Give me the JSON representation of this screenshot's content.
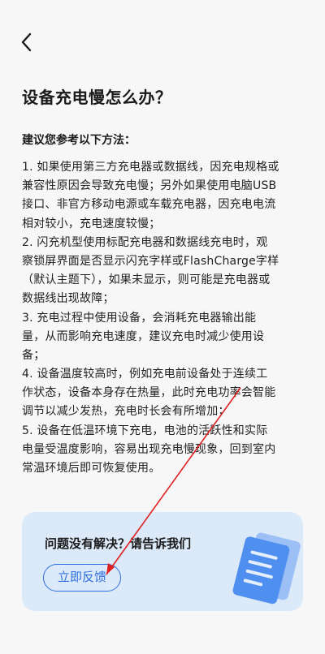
{
  "header": {
    "back_icon": "chevron-left-icon"
  },
  "page": {
    "title": "设备充电慢怎么办？",
    "section_title": "建议您参考以下方法："
  },
  "tips_lines": [
    "1. 如果使用第三方充电器或数据线，因充电规格或",
    "兼容性原因会导致充电慢；另外如果使用电脑USB",
    "接口、非官方移动电源或车载充电器，因充电电流",
    "相对较小，充电速度较慢；",
    "2. 闪充机型使用标配充电器和数据线充电时，观",
    "察锁屏界面是否显示闪充字样或FlashCharge字样",
    "（默认主题下），如果未显示，则可能是充电器或",
    "数据线出现故障；",
    "3. 充电过程中使用设备，会消耗充电器输出能",
    "量，从而影响充电速度，建议充电时减少使用设",
    "备；",
    "4. 设备温度较高时，例如充电前设备处于连续工",
    "作状态，设备本身存在热量，此时充电功率会智能",
    "调节以减少发热，充电时长会有所增加；",
    "5. 设备在低温环境下充电，电池的活跃性和实际",
    "电量受温度影响，容易出现充电慢现象，回到室内",
    "常温环境后即可恢复使用。"
  ],
  "feedback": {
    "question": "问题没有解决？请告诉我们",
    "button_label": "立即反馈",
    "illustration_icon": "document-icon"
  },
  "colors": {
    "background": "#f7f7f8",
    "card_background": "#dce9f8",
    "accent": "#2d6fe0",
    "annotation": "#e02020"
  }
}
